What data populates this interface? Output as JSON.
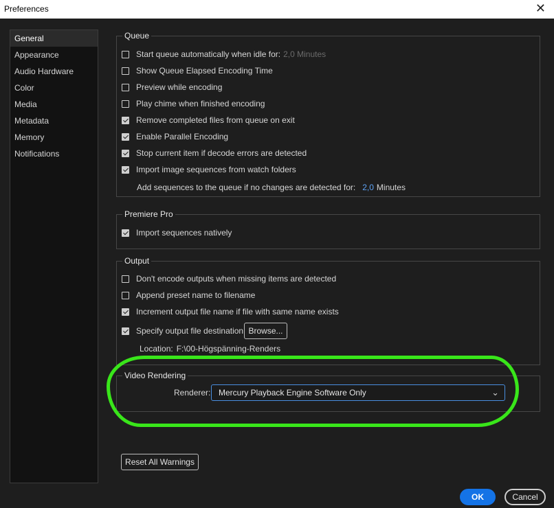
{
  "window": {
    "title": "Preferences",
    "close_glyph": "✕"
  },
  "sidebar": {
    "items": [
      {
        "label": "General",
        "active": true
      },
      {
        "label": "Appearance"
      },
      {
        "label": "Audio Hardware"
      },
      {
        "label": "Color"
      },
      {
        "label": "Media"
      },
      {
        "label": "Metadata"
      },
      {
        "label": "Memory"
      },
      {
        "label": "Notifications"
      }
    ]
  },
  "queue": {
    "label": "Queue",
    "start_auto": {
      "label": "Start queue automatically when idle for:",
      "checked": false,
      "value": "2,0 Minutes"
    },
    "show_elapsed": {
      "label": "Show Queue Elapsed Encoding Time",
      "checked": false
    },
    "preview": {
      "label": "Preview while encoding",
      "checked": false
    },
    "chime": {
      "label": "Play chime when finished encoding",
      "checked": false
    },
    "remove_completed": {
      "label": "Remove completed files from queue on exit",
      "checked": true
    },
    "parallel": {
      "label": "Enable Parallel Encoding",
      "checked": true
    },
    "stop_decode": {
      "label": "Stop current item if decode errors are detected",
      "checked": true
    },
    "import_sequences": {
      "label": "Import image sequences from watch folders",
      "checked": true
    },
    "add_sequences": {
      "label": "Add sequences to the queue if no changes are detected for:",
      "value": "2,0",
      "unit": "Minutes"
    }
  },
  "premiere": {
    "label": "Premiere Pro",
    "import_native": {
      "label": "Import sequences natively",
      "checked": true
    }
  },
  "output": {
    "label": "Output",
    "dont_encode": {
      "label": "Don't encode outputs when missing items are detected",
      "checked": false
    },
    "append_preset": {
      "label": "Append preset name to filename",
      "checked": false
    },
    "increment": {
      "label": "Increment output file name if file with same name exists",
      "checked": true
    },
    "specify_dest": {
      "label": "Specify output file destination:",
      "checked": true
    },
    "browse_label": "Browse...",
    "location_label": "Location:",
    "location_value": "F:\\00-Högspänning-Renders"
  },
  "video_rendering": {
    "label": "Video Rendering",
    "renderer_label": "Renderer:",
    "renderer_value": "Mercury Playback Engine Software Only"
  },
  "footer": {
    "reset_label": "Reset All Warnings",
    "ok_label": "OK",
    "cancel_label": "Cancel"
  },
  "colors": {
    "accent": "#1473e6",
    "annotation": "#39e61a"
  }
}
